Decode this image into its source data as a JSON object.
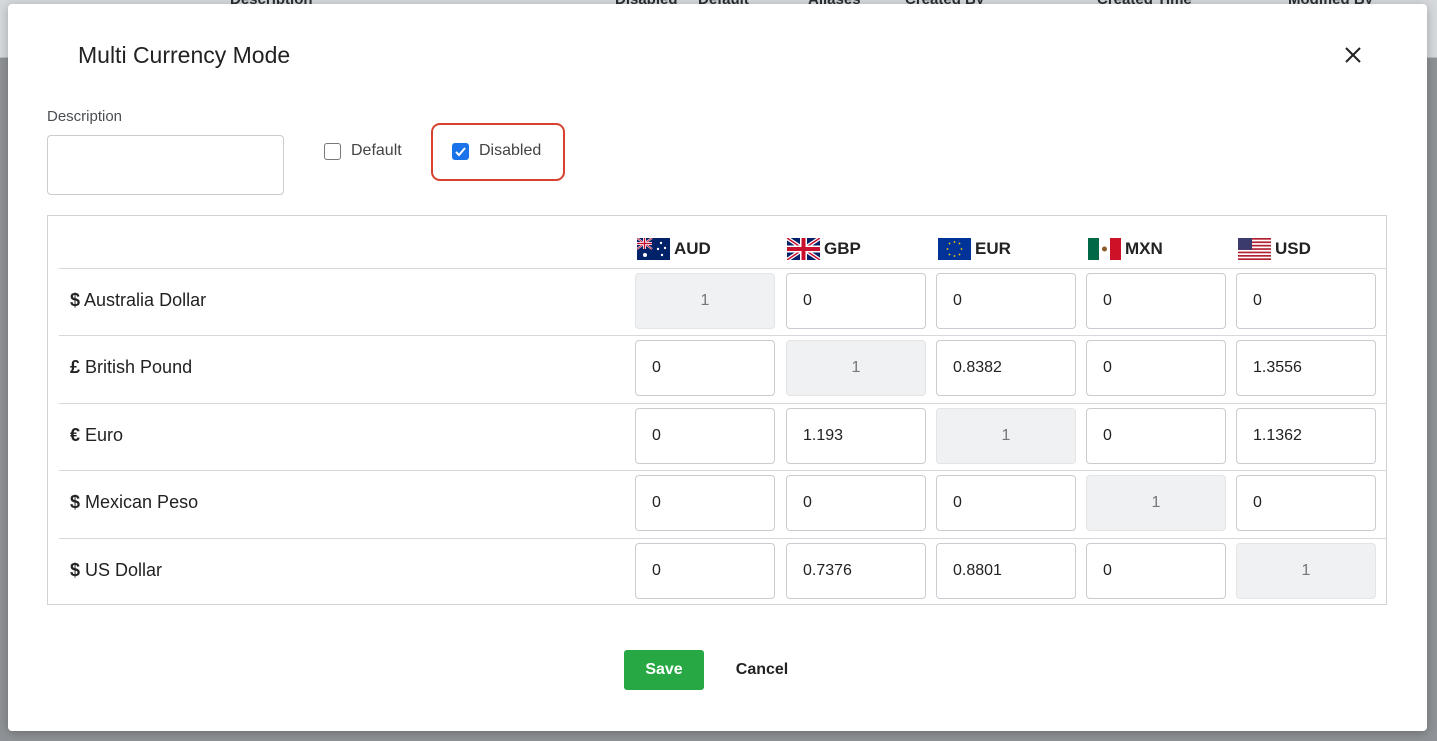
{
  "background": {
    "headers": [
      "Description",
      "Disabled",
      "Default",
      "Aliases",
      "Created By",
      "Created Time",
      "Modified By"
    ]
  },
  "modal": {
    "title": "Multi Currency Mode",
    "description": {
      "label": "Description",
      "value": "",
      "placeholder": ""
    },
    "default_checkbox": {
      "label": "Default",
      "checked": false
    },
    "disabled_checkbox": {
      "label": "Disabled",
      "checked": true
    },
    "highlight_color": "#d9412e",
    "columns": [
      {
        "code": "AUD",
        "flag": "australia-flag-icon"
      },
      {
        "code": "GBP",
        "flag": "uk-flag-icon"
      },
      {
        "code": "EUR",
        "flag": "eu-flag-icon"
      },
      {
        "code": "MXN",
        "flag": "mexico-flag-icon"
      },
      {
        "code": "USD",
        "flag": "us-flag-icon"
      }
    ],
    "rows": [
      {
        "symbol": "$",
        "name": "Australia Dollar",
        "values": [
          "1",
          "0",
          "0",
          "0",
          "0"
        ]
      },
      {
        "symbol": "£",
        "name": "British Pound",
        "values": [
          "0",
          "1",
          "0.8382",
          "0",
          "1.3556"
        ]
      },
      {
        "symbol": "€",
        "name": "Euro",
        "values": [
          "0",
          "1.193",
          "1",
          "0",
          "1.1362"
        ]
      },
      {
        "symbol": "$",
        "name": "Mexican Peso",
        "values": [
          "0",
          "0",
          "0",
          "1",
          "0"
        ]
      },
      {
        "symbol": "$",
        "name": "US Dollar",
        "values": [
          "0",
          "0.7376",
          "0.8801",
          "0",
          "1"
        ]
      }
    ],
    "save_label": "Save",
    "cancel_label": "Cancel",
    "save_color": "#28a745"
  }
}
